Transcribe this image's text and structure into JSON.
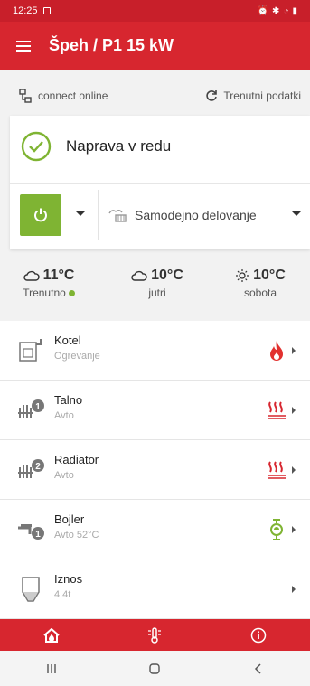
{
  "status_bar": {
    "time": "12:25"
  },
  "app_bar": {
    "title": "Špeh / P1 15 kW"
  },
  "connection": {
    "label": "connect online",
    "current_data": "Trenutni podatki"
  },
  "device_status": {
    "text": "Naprava v redu",
    "mode": "Samodejno delovanje"
  },
  "weather": [
    {
      "temp": "11°C",
      "label": "Trenutno",
      "icon": "cloud-icon"
    },
    {
      "temp": "10°C",
      "label": "jutri",
      "icon": "cloud-icon"
    },
    {
      "temp": "10°C",
      "label": "sobota",
      "icon": "sun-icon"
    }
  ],
  "devices": [
    {
      "title": "Kotel",
      "subtitle": "Ogrevanje",
      "status_icon": "flame-icon"
    },
    {
      "title": "Talno",
      "subtitle": "Avto",
      "status_icon": "heat-waves-icon"
    },
    {
      "title": "Radiator",
      "subtitle": "Avto",
      "status_icon": "heat-waves-icon"
    },
    {
      "title": "Bojler",
      "subtitle": "Avto 52°C",
      "status_icon": "pump-icon"
    },
    {
      "title": "Iznos",
      "subtitle": "4.4t",
      "status_icon": ""
    }
  ],
  "colors": {
    "red": "#d7262f",
    "green": "#7fb433"
  }
}
